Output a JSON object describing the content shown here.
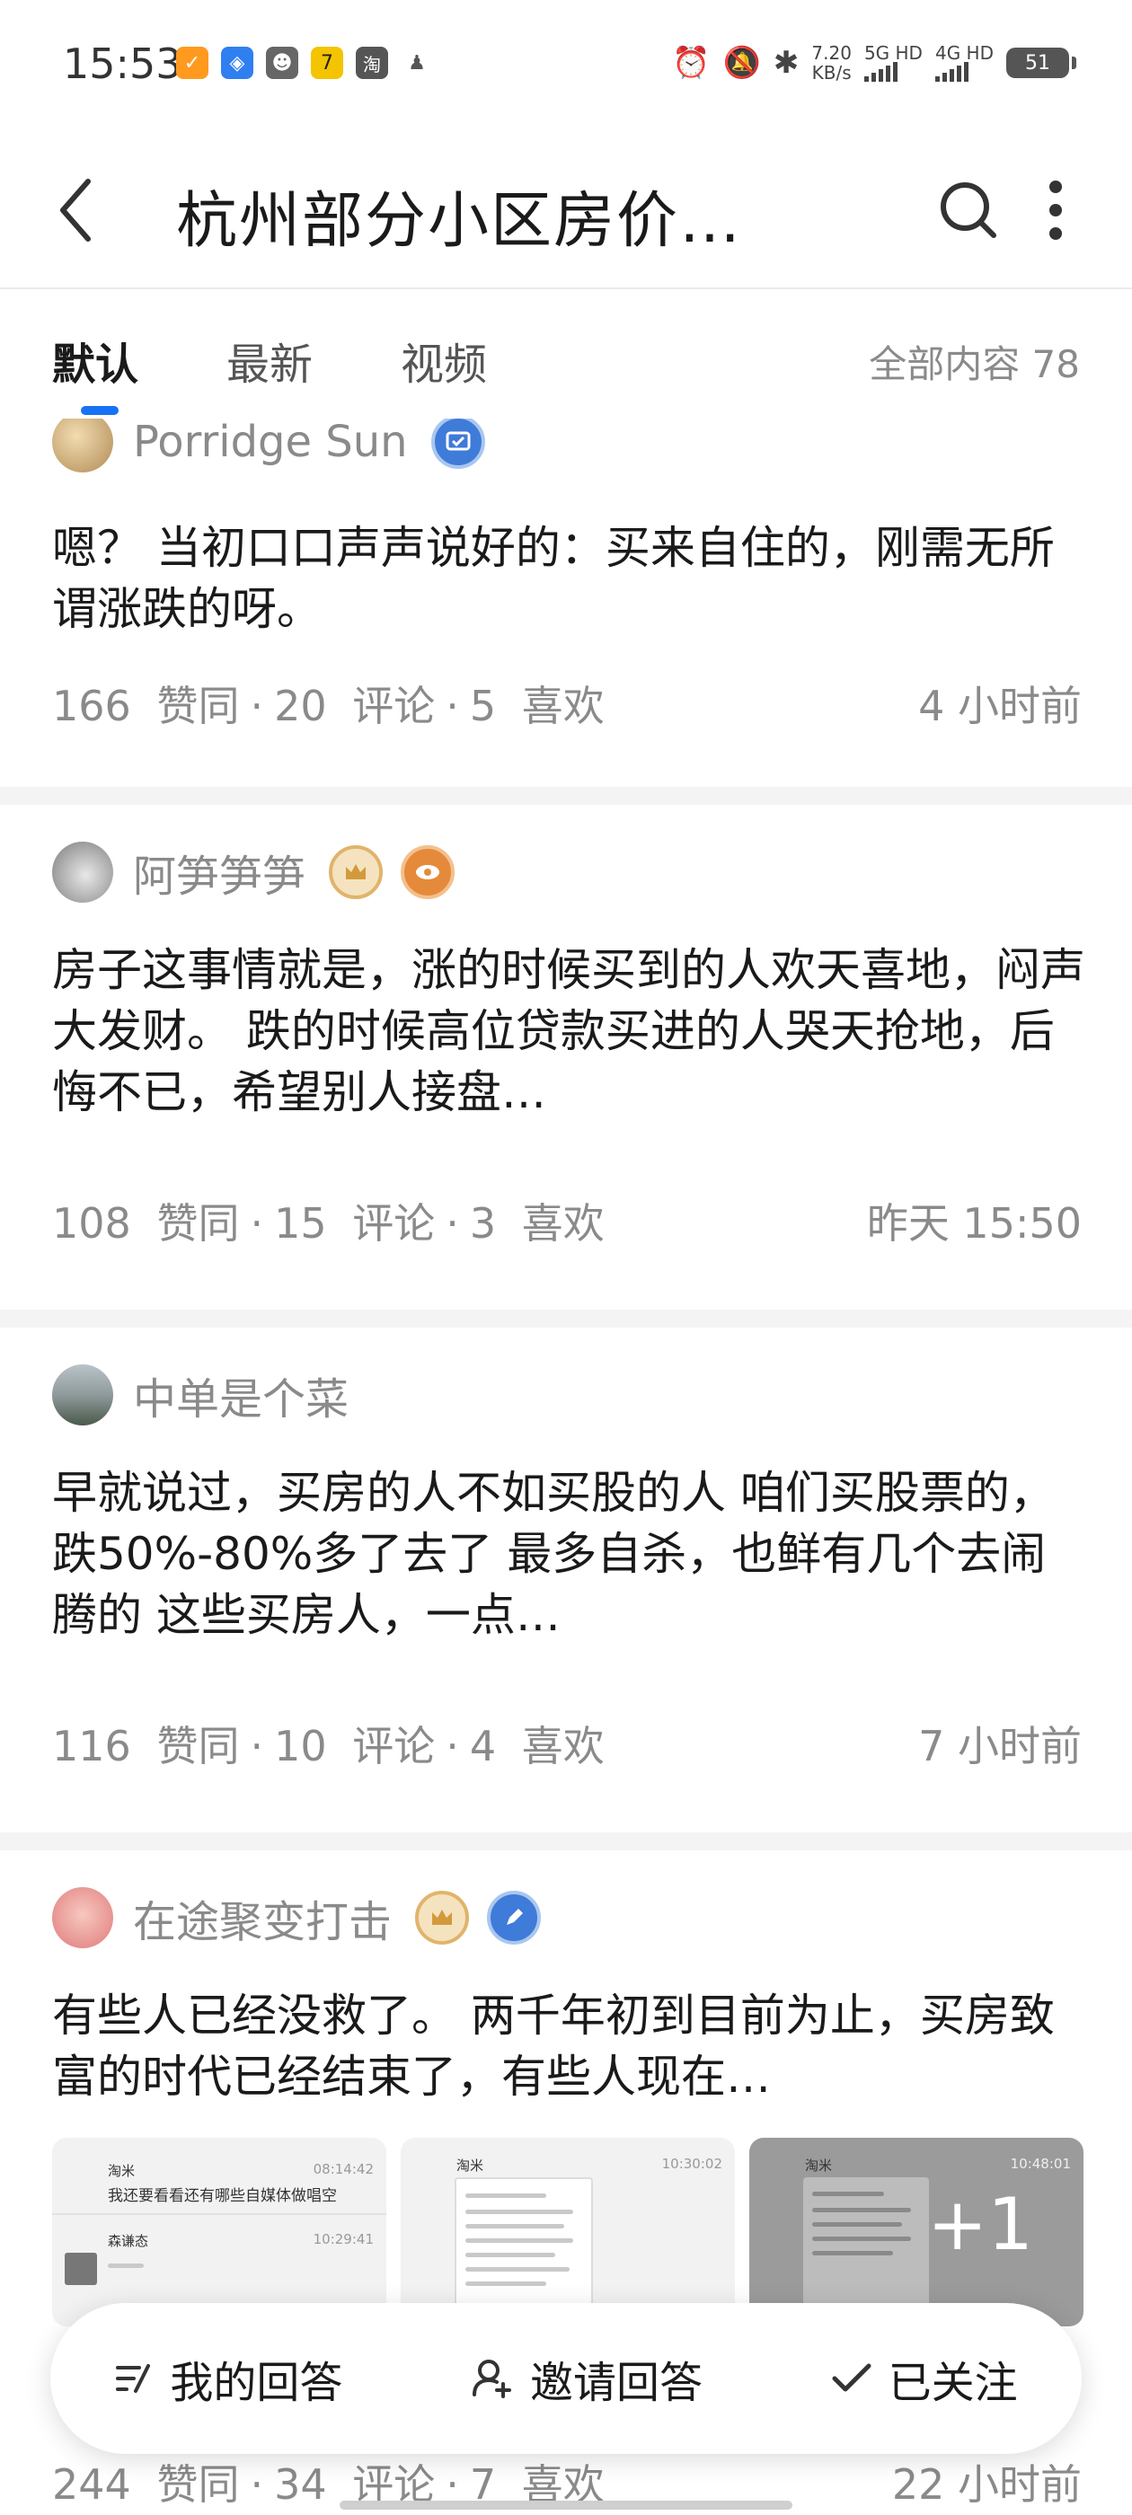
{
  "status_bar": {
    "time": "15:53",
    "apps": [
      {
        "icon": "orange-app-icon",
        "color": "#ff9a1f",
        "glyph": "✓"
      },
      {
        "icon": "shield-app-icon",
        "color": "#2f7ff0",
        "glyph": "◈"
      },
      {
        "icon": "cat-app-icon",
        "color": "#666666",
        "glyph": "☻"
      },
      {
        "icon": "seven-app-icon",
        "color": "#f5c400",
        "glyph": "7"
      },
      {
        "icon": "taobao-app-icon",
        "color": "#555555",
        "glyph": "淘"
      },
      {
        "icon": "qq-app-icon",
        "color": "#555555",
        "glyph": "♟"
      }
    ],
    "speed_value": "7.20",
    "speed_unit": "KB/s",
    "net1": "5G HD",
    "net2": "4G HD",
    "battery": "51"
  },
  "header": {
    "title": "杭州部分小区房价…"
  },
  "tabs": {
    "items": [
      "默认",
      "最新",
      "视频"
    ],
    "active": "默认",
    "count_label": "全部内容 78"
  },
  "answers": [
    {
      "author": "Porridge Sun",
      "text": "嗯？ 当初口口声声说好的：买来自住的，刚需无所谓涨跌的呀。",
      "likes": "166",
      "likes_label": "赞同",
      "comments": "20",
      "comments_label": "评论",
      "favs": "5",
      "favs_label": "喜欢",
      "time": "4 小时前"
    },
    {
      "author": "阿笋笋笋",
      "text": "房子这事情就是，涨的时候买到的人欢天喜地，闷声大发财。 跌的时候高位贷款买进的人哭天抢地，后悔不已，希望别人接盘…",
      "likes": "108",
      "likes_label": "赞同",
      "comments": "15",
      "comments_label": "评论",
      "favs": "3",
      "favs_label": "喜欢",
      "time": "昨天 15:50"
    },
    {
      "author": "中单是个菜",
      "text": "早就说过，买房的人不如买股的人 咱们买股票的，跌50%-80%多了去了 最多自杀，也鲜有几个去闹腾的 这些买房人，一点…",
      "likes": "116",
      "likes_label": "赞同",
      "comments": "10",
      "comments_label": "评论",
      "favs": "4",
      "favs_label": "喜欢",
      "time": "7 小时前"
    },
    {
      "author": "在途聚变打击",
      "text": "有些人已经没救了。 两千年初到目前为止，买房致富的时代已经结束了，有些人现在…",
      "image_texts": [
        {
          "top_left": "淘米",
          "top_right": "08:14:42",
          "line": "我还要看看还有哪些自媒体做唱空",
          "sub_left": "森谦态",
          "sub_right": "10:29:41"
        },
        {
          "top_left": "淘米",
          "top_right": "10:30:02"
        },
        {
          "top_left": "淘米",
          "top_right": "10:48:01",
          "more": "+1"
        }
      ],
      "likes": "244",
      "likes_label": "赞同",
      "comments": "34",
      "comments_label": "评论",
      "favs": "7",
      "favs_label": "喜欢",
      "time": "22 小时前"
    }
  ],
  "bottom_bar": {
    "my_answer": "我的回答",
    "invite": "邀请回答",
    "followed": "已关注"
  },
  "colors": {
    "accent": "#1772f6",
    "muted_text": "#8a8a8a",
    "divider": "#f4f4f5"
  }
}
